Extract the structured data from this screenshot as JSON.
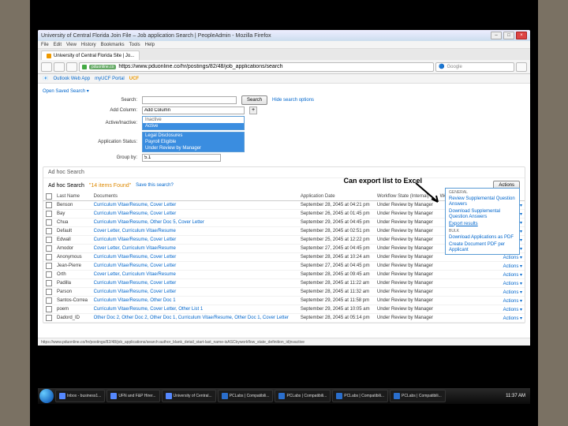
{
  "window": {
    "title": "University of Central Florida Join File – Job application Search | PeopleAdmin - Mozilla Firefox",
    "tab": "University of Central Florida Site | Jo..."
  },
  "menubar": [
    "File",
    "Edit",
    "View",
    "History",
    "Bookmarks",
    "Tools",
    "Help"
  ],
  "nav": {
    "url_tag": "pduonline.co",
    "url": "https://www.pduonline.co/hr/postings/82/48/job_applications/search",
    "search_placeholder": "Google"
  },
  "bookmarks": [
    "Outlook Web App",
    "myUCF Portal",
    "UCF"
  ],
  "search_area": {
    "saved_search": "Open Saved Search ▾",
    "search_label": "Search:",
    "search_btn": "Search",
    "hide_opts": "Hide search options",
    "add_column": "Add Column:",
    "add_column_value": "Add Column",
    "active_label": "Active/Inactive:",
    "active_options": [
      "Active",
      "Inactive"
    ],
    "app_status_label": "Application Status:",
    "app_status_options": [
      "Legal Disclosures",
      "Payroll Eligible",
      "Under Review by Manager"
    ],
    "group_label": "Group by:",
    "group_value": "5.1"
  },
  "results": {
    "panel_title": "Ad hoc Search",
    "results_label": "Ad hoc Search",
    "count_text": "\"14 items Found\"",
    "save_link": "Save this search?",
    "actions_btn": "Actions"
  },
  "callout": "Can export list to Excel",
  "actions_menu": {
    "sect1": "GENERAL",
    "i1": "Review Supplemental Question Answers",
    "i2": "Download Supplemental Question Answers",
    "i3": "Export results",
    "sect2": "BULK",
    "i4": "Download Applications as PDF",
    "i5": "Create Document PDF per Applicant"
  },
  "cols": {
    "c0": "",
    "c1": "Last Name",
    "c2": "Documents",
    "c3": "Application Date",
    "c4": "Workflow State (Internal)",
    "c5": "Workflow State (Category)",
    "c6": ""
  },
  "rows": [
    {
      "n": "Benson",
      "d": "Curriculum Vitae/Resume, Cover Letter",
      "dt": "September 28, 2045 at 04:21 pm",
      "w": "Under Review by Manager",
      "a": "Actions ▾"
    },
    {
      "n": "Bay",
      "d": "Curriculum Vitae/Resume, Cover Letter",
      "dt": "September 26, 2045 at 01:45 pm",
      "w": "Under Review by Manager",
      "a": "Actions ▾"
    },
    {
      "n": "Chua",
      "d": "Curriculum Vitae/Resume, Other Doc 5, Cover Letter",
      "dt": "September 29, 2045 at 04:45 pm",
      "w": "Under Review by Manager",
      "a": "Actions ▾"
    },
    {
      "n": "Default",
      "d": "Cover Letter, Curriculum Vitae/Resume",
      "dt": "September 28, 2045 at 02:51 pm",
      "w": "Under Review by Manager",
      "a": "Actions ▾"
    },
    {
      "n": "Edwall",
      "d": "Curriculum Vitae/Resume, Cover Letter",
      "dt": "September 25, 2045 at 12:22 pm",
      "w": "Under Review by Manager",
      "a": "Actions ▾"
    },
    {
      "n": "Amodor",
      "d": "Cover Letter, Curriculum Vitae/Resume",
      "dt": "September 27, 2045 at 04:45 pm",
      "w": "Under Review by Manager",
      "a": "Actions ▾"
    },
    {
      "n": "Anonymous",
      "d": "Curriculum Vitae/Resume, Cover Letter",
      "dt": "September 28, 2045 at 10:24 am",
      "w": "Under Review by Manager",
      "a": "Actions ▾"
    },
    {
      "n": "Jean-Pierre",
      "d": "Curriculum Vitae/Resume, Cover Letter",
      "dt": "September 27, 2045 at 04:45 pm",
      "w": "Under Review by Manager",
      "a": "Actions ▾"
    },
    {
      "n": "Orth",
      "d": "Cover Letter, Curriculum Vitae/Resume",
      "dt": "September 28, 2045 at 09:45 am",
      "w": "Under Review by Manager",
      "a": "Actions ▾"
    },
    {
      "n": "Padilla",
      "d": "Curriculum Vitae/Resume, Cover Letter",
      "dt": "September 28, 2045 at 11:22 am",
      "w": "Under Review by Manager",
      "a": "Actions ▾"
    },
    {
      "n": "Parson",
      "d": "Curriculum Vitae/Resume, Cover Letter",
      "dt": "September 28, 2045 at 11:32 am",
      "w": "Under Review by Manager",
      "a": "Actions ▾"
    },
    {
      "n": "Santos-Correa",
      "d": "Curriculum Vitae/Resume, Other Doc 1",
      "dt": "September 29, 2045 at 11:58 pm",
      "w": "Under Review by Manager",
      "a": "Actions ▾"
    },
    {
      "n": "poem",
      "d": "Curriculum Vitae/Resume, Cover Letter, Other List 1",
      "dt": "September 29, 2045 at 10:05 am",
      "w": "Under Review by Manager",
      "a": "Actions ▾"
    },
    {
      "n": "Dadord_ID",
      "d": "Other Doc 2, Other Doc 2, Other Doc 1, Curriculum Vitae/Resume, Other Doc 1, Cover Letter",
      "dt": "September 28, 2045 at 05:14 pm",
      "w": "Under Review by Manager",
      "a": "Actions ▾"
    }
  ],
  "statusbar": "https://www.pduonline.co/hr/postings/82/48/job_applications/search:author_blank_detail_start-last_name-isASCbyworkflow_state_definition_id|nvactive",
  "taskbar": {
    "items": [
      "Inbox - business1...",
      "UFN and F&P Hirer...",
      "University of Central...",
      "PCLabs | Compatibili...",
      "PCLabs | Compatibili...",
      "PCLabs | Compatibili...",
      "PCLabs | Compatibili..."
    ],
    "clock": "11:37 AM"
  }
}
